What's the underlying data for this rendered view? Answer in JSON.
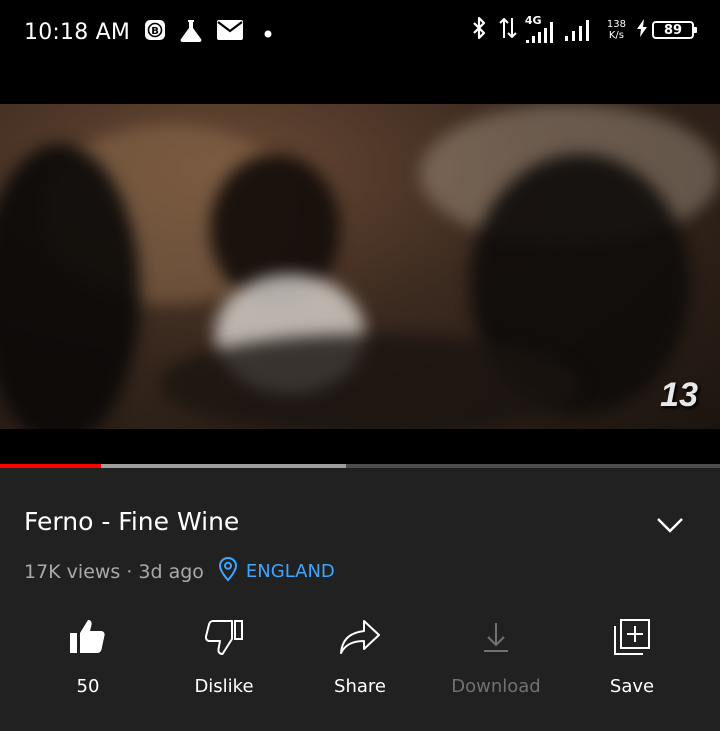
{
  "status_bar": {
    "time": "10:18 AM",
    "network_type": "4G",
    "speed_value": "138",
    "speed_unit": "K/s",
    "battery_level": "89",
    "icons": [
      "b-badge-icon",
      "flask-icon",
      "mail-icon",
      "dot-icon",
      "bluetooth-icon",
      "data-transfer-icon",
      "signal-icon",
      "signal-icon-2",
      "charging-icon",
      "battery-icon"
    ]
  },
  "player": {
    "overlay_badge": "13",
    "progress_played_fraction": 0.14,
    "progress_buffered_fraction": 0.48,
    "colors": {
      "played": "#ff0000",
      "buffered": "#9e9e9e",
      "track": "#4d4d4d"
    }
  },
  "video_info": {
    "title": "Ferno - Fine Wine",
    "views": "17K views",
    "separator": "·",
    "age": "3d ago",
    "location": "ENGLAND",
    "location_color": "#3ea6ff"
  },
  "actions": [
    {
      "label": "50",
      "icon": "thumbs-up-icon",
      "enabled": true
    },
    {
      "label": "Dislike",
      "icon": "thumbs-down-icon",
      "enabled": true
    },
    {
      "label": "Share",
      "icon": "share-icon",
      "enabled": true
    },
    {
      "label": "Download",
      "icon": "download-icon",
      "enabled": false
    },
    {
      "label": "Save",
      "icon": "save-playlist-icon",
      "enabled": true
    }
  ]
}
